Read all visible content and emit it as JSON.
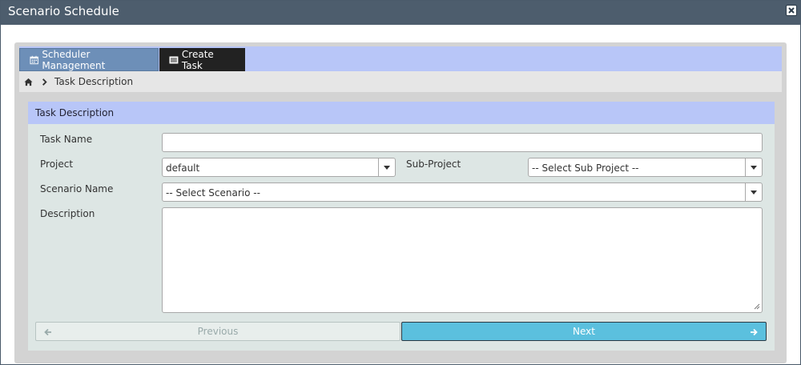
{
  "window": {
    "title": "Scenario Schedule"
  },
  "tabs": [
    {
      "label": "Scheduler Management",
      "icon": "calendar-icon"
    },
    {
      "label": "Create Task",
      "icon": "tasks-icon"
    }
  ],
  "breadcrumb": {
    "icon": "home-icon",
    "current": "Task Description"
  },
  "panel": {
    "title": "Task Description",
    "fields": {
      "task_name": {
        "label": "Task Name",
        "value": "",
        "placeholder": ""
      },
      "project": {
        "label": "Project",
        "value": "default"
      },
      "sub_project": {
        "label": "Sub-Project",
        "value": "-- Select Sub Project --"
      },
      "scenario_name": {
        "label": "Scenario Name",
        "value": "-- Select Scenario --"
      },
      "description": {
        "label": "Description",
        "value": ""
      }
    }
  },
  "buttons": {
    "previous": "Previous",
    "next": "Next"
  },
  "colors": {
    "titlebar": "#4d5d6d",
    "tab_active": "#6d8fb8",
    "tab_dark": "#222222",
    "panel_head": "#b8c6f8",
    "next_button": "#5bc0de"
  }
}
